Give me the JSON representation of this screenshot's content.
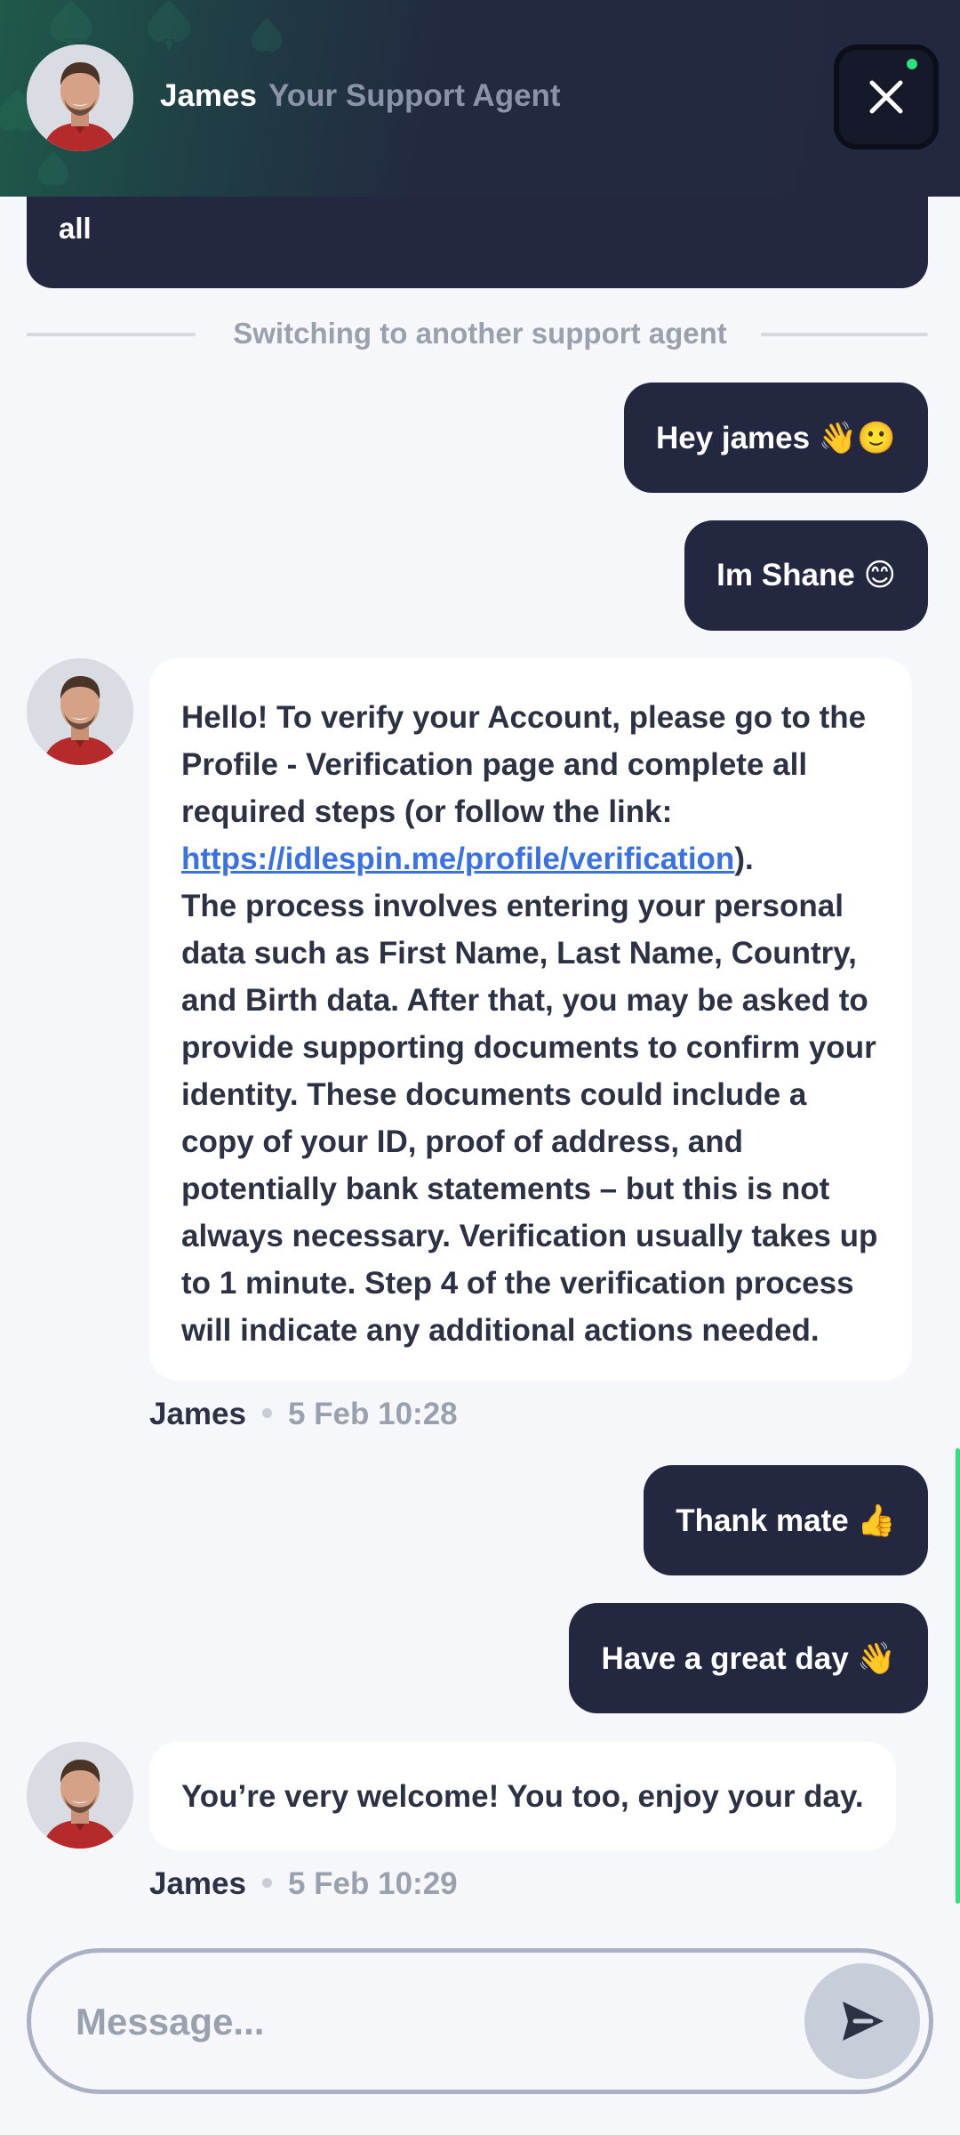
{
  "header": {
    "agent_name": "James",
    "agent_role": "Your Support Agent",
    "online_color": "#2fe07f"
  },
  "chat": {
    "previous_bubble_tail": "all",
    "divider": "Switching to another support agent",
    "messages": [
      {
        "from": "user",
        "text": "Hey james 👋🙂"
      },
      {
        "from": "user",
        "text": "Im Shane 😊"
      },
      {
        "from": "agent",
        "text_intro": "Hello! To verify your Account, please go to the Profile - Verification page and complete all required steps (or follow the link: ",
        "link": "https://idlespin.me/profile/verification",
        "text_after_link": ").",
        "text_body": "The process involves entering your personal data such as First Name, Last Name, Country, and Birth data. After that, you may be asked to provide supporting documents to confirm your identity. These documents could include a copy of your ID, proof of address, and potentially bank statements – but this is not always necessary. Verification usually takes up to 1 minute. Step 4 of the verification process will indicate any additional actions needed.",
        "author": "James",
        "time": "5 Feb 10:28"
      },
      {
        "from": "user",
        "text": "Thank mate 👍"
      },
      {
        "from": "user",
        "text": "Have a great day 👋"
      },
      {
        "from": "agent",
        "text": "You’re very welcome! You too, enjoy your day.",
        "author": "James",
        "time": "5 Feb 10:29"
      }
    ]
  },
  "composer": {
    "placeholder": "Message..."
  }
}
